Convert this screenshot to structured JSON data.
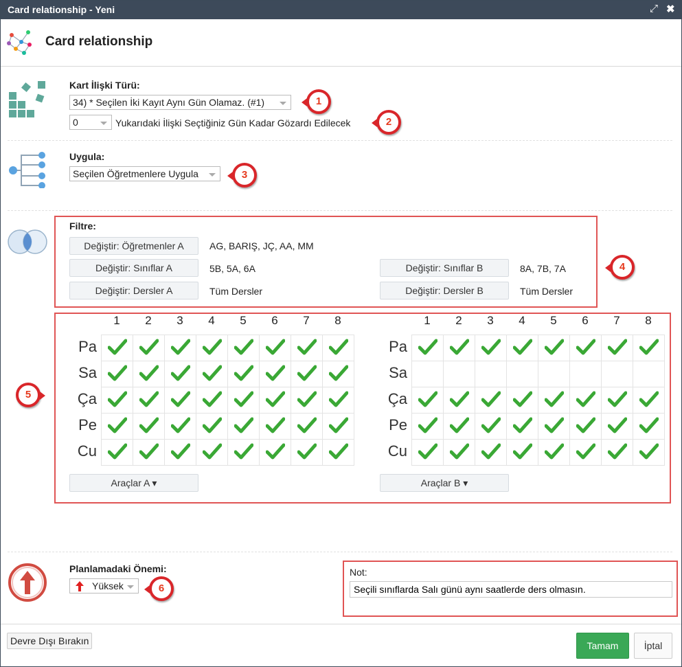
{
  "window": {
    "title": "Card relationship - Yeni",
    "maximize_icon": "expand-icon",
    "close_icon": "close-icon"
  },
  "header": {
    "title": "Card relationship",
    "icon": "network-icon"
  },
  "relation": {
    "label": "Kart İlişki Türü:",
    "type_value": "34) * Seçilen İki Kayıt Aynı Gün Olamaz. (#1)",
    "days_value": "0",
    "days_text": "Yukarıdaki İlişki Seçtiğiniz Gün Kadar Gözardı Edilecek"
  },
  "apply": {
    "label": "Uygula:",
    "value": "Seçilen Öğretmenlere Uygula"
  },
  "filter": {
    "label": "Filtre:",
    "teachers_a_button": "Değiştir: Öğretmenler A",
    "teachers_a_value": "AG, BARIŞ, JÇ, AA, MM",
    "classes_a_button": "Değiştir: Sınıflar A",
    "classes_a_value": "5B, 5A, 6A",
    "classes_b_button": "Değiştir: Sınıflar B",
    "classes_b_value": "8A, 7B, 7A",
    "lessons_a_button": "Değiştir: Dersler A",
    "lessons_a_value": "Tüm Dersler",
    "lessons_b_button": "Değiştir: Dersler B",
    "lessons_b_value": "Tüm Dersler"
  },
  "grid": {
    "periods": [
      "1",
      "2",
      "3",
      "4",
      "5",
      "6",
      "7",
      "8"
    ],
    "days": [
      "Pa",
      "Sa",
      "Ça",
      "Pe",
      "Cu"
    ],
    "a": {
      "checked": [
        [
          1,
          1,
          1,
          1,
          1,
          1,
          1,
          1
        ],
        [
          1,
          1,
          1,
          1,
          1,
          1,
          1,
          1
        ],
        [
          1,
          1,
          1,
          1,
          1,
          1,
          1,
          1
        ],
        [
          1,
          1,
          1,
          1,
          1,
          1,
          1,
          1
        ],
        [
          1,
          1,
          1,
          1,
          1,
          1,
          1,
          1
        ]
      ],
      "tools_button": "Araçlar A ▾"
    },
    "b": {
      "checked": [
        [
          1,
          1,
          1,
          1,
          1,
          1,
          1,
          1
        ],
        [
          0,
          0,
          0,
          0,
          0,
          0,
          0,
          0
        ],
        [
          1,
          1,
          1,
          1,
          1,
          1,
          1,
          1
        ],
        [
          1,
          1,
          1,
          1,
          1,
          1,
          1,
          1
        ],
        [
          1,
          1,
          1,
          1,
          1,
          1,
          1,
          1
        ]
      ],
      "tools_button": "Araçlar B ▾"
    },
    "check_color": "#3aa835"
  },
  "importance": {
    "label": "Planlamadaki Önemi:",
    "value": "Yüksek",
    "icon": "arrow-up-icon"
  },
  "note": {
    "label": "Not:",
    "value": "Seçili sınıflarda Salı günü aynı saatlerde ders olmasın."
  },
  "footer": {
    "disable_button": "Devre Dışı Bırakın",
    "ok_button": "Tamam",
    "cancel_button": "İptal"
  },
  "badges": [
    "1",
    "2",
    "3",
    "4",
    "5",
    "6"
  ],
  "colors": {
    "titlebar": "#3d4a5a",
    "badge": "#d9262a",
    "ok": "#3aa856",
    "highlight": "#e05454"
  }
}
